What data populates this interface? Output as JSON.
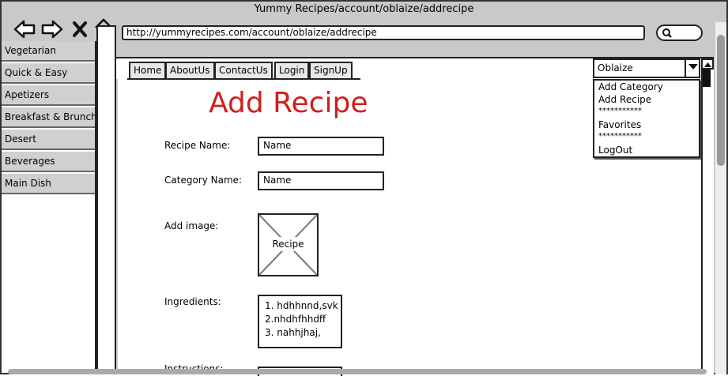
{
  "window": {
    "title": "Yummy Recipes/account/oblaize/addrecipe"
  },
  "browser": {
    "url": "http://yummyrecipes.com/account/oblaize/addrecipe"
  },
  "sidebar": {
    "items": [
      {
        "label": "Vegetarian"
      },
      {
        "label": "Quick & Easy"
      },
      {
        "label": "Apetizers"
      },
      {
        "label": "Breakfast & Brunch"
      },
      {
        "label": "Desert"
      },
      {
        "label": "Beverages"
      },
      {
        "label": "Main Dish"
      }
    ]
  },
  "tabs": [
    {
      "label": "Home"
    },
    {
      "label": "AboutUs"
    },
    {
      "label": "ContactUs"
    },
    {
      "label": "Login"
    },
    {
      "label": "SignUp"
    }
  ],
  "user_menu": {
    "selected": "Oblaize",
    "items": [
      {
        "label": "Add Category"
      },
      {
        "label": "Add Recipe"
      },
      {
        "label": "***********"
      },
      {
        "label": "Favorites"
      },
      {
        "label": "***********"
      },
      {
        "label": "LogOut"
      }
    ]
  },
  "form": {
    "title": "Add Recipe",
    "title_color": "#d01f1f",
    "recipe_name_label": "Recipe Name:",
    "recipe_name_value": "Name",
    "category_name_label": "Category Name:",
    "category_name_value": "Name",
    "image_label": "Add image:",
    "image_caption": "Recipe",
    "ingredients_label": "Ingredients:",
    "ingredients_lines": [
      "1. hdhhnnd,svk",
      "2.nhdhfhhdff",
      "3. nahhjhaj,"
    ],
    "instructions_label": "Instructions:"
  }
}
